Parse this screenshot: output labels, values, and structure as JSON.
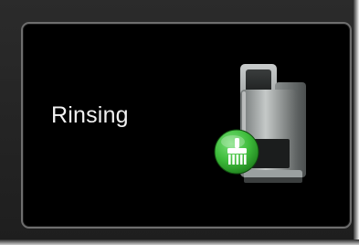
{
  "screen": {
    "status_text": "Rinsing"
  },
  "icons": {
    "machine": "coffee-machine-icon",
    "badge": "rinse-brush-icon"
  },
  "colors": {
    "screen_background": "#000000",
    "text": "#f1f1f1",
    "badge_green": "#3dbb3a",
    "machine_gray": "#8a8f8f"
  }
}
